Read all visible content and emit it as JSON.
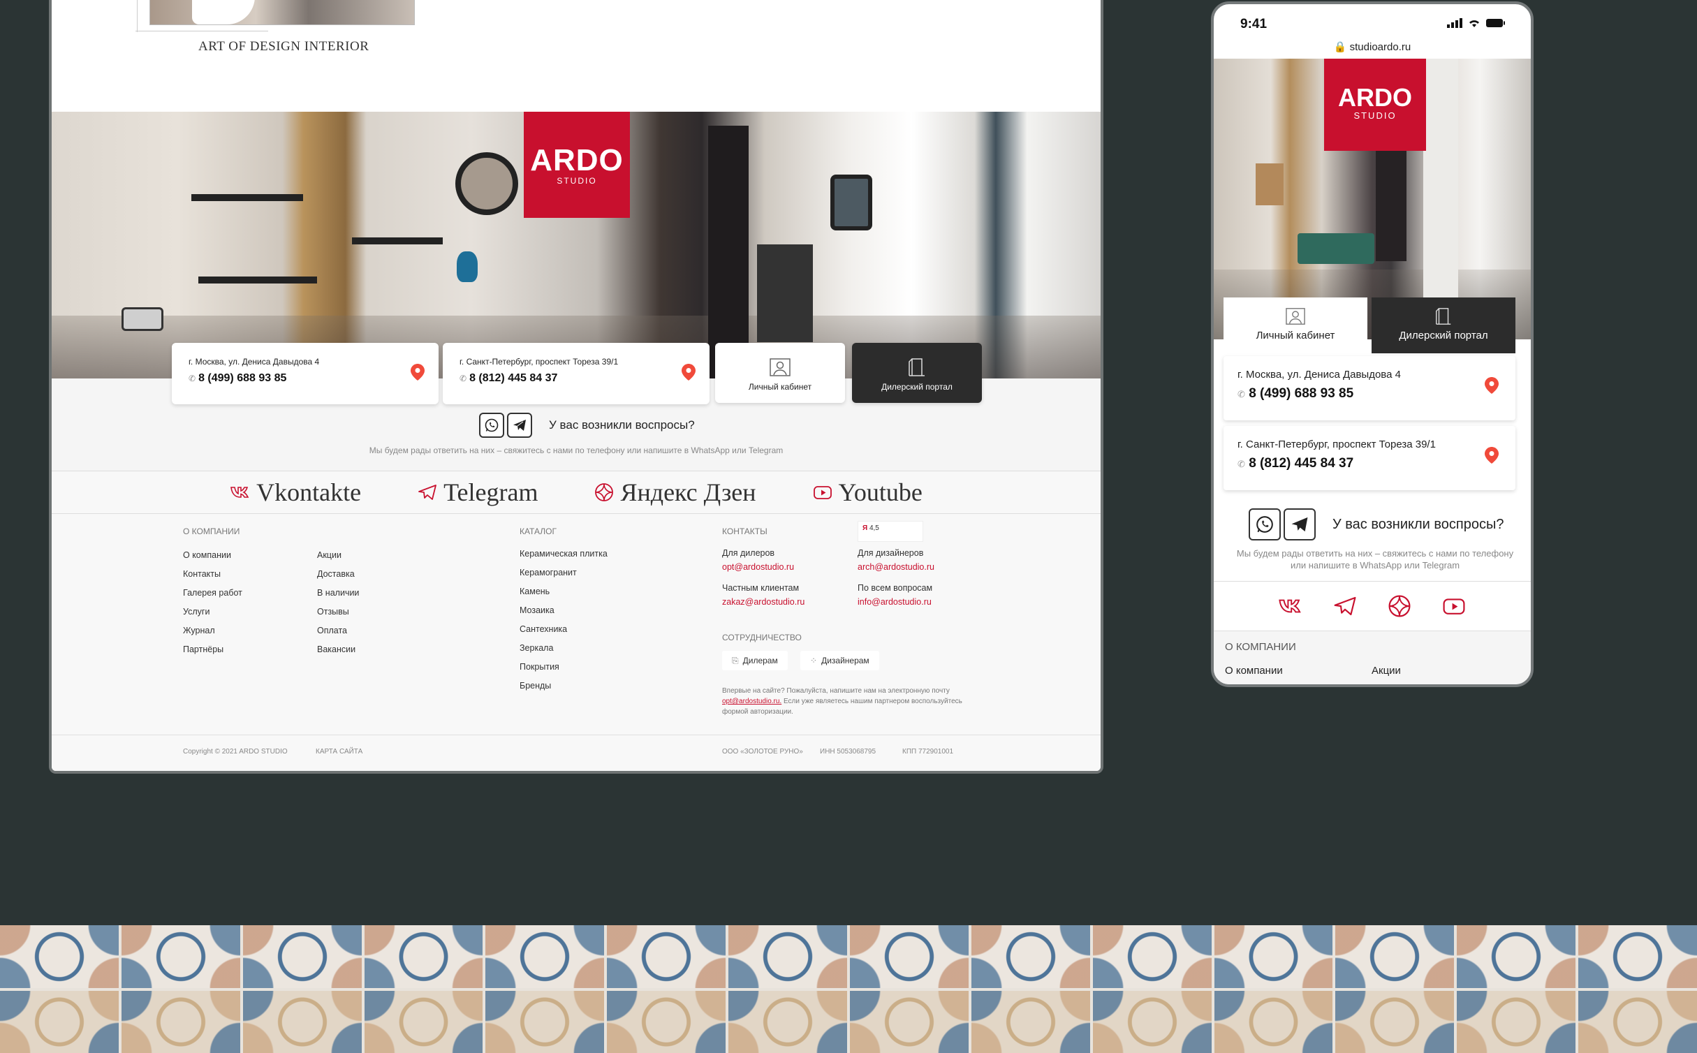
{
  "brand": {
    "name": "ARDO",
    "sub": "STUDIO",
    "tagline": "ART OF DESIGN INTERIOR",
    "accent": "#c8102e",
    "dark": "#2c2c2c",
    "background": "#2b3434"
  },
  "contacts": {
    "moscow": {
      "address": "г. Москва, ул. Дениса Давыдова 4",
      "phone": "8 (499) 688 93 85"
    },
    "spb": {
      "address": "г. Санкт-Петербург, проспект Тореза 39/1",
      "phone": "8 (812) 445 84 37"
    }
  },
  "buttons": {
    "cabinet": "Личный кабинет",
    "dealer": "Дилерский портал"
  },
  "question": {
    "title": "У вас возникли воспросы?",
    "subtitle": "Мы будем рады ответить на них – свяжитесь с нами по телефону или напишите в WhatsApp или Telegram",
    "mobile_sub_1": "Мы будем рады ответить на них – свяжитесь с нами по телефону",
    "mobile_sub_2": "или напишите в WhatsApp или Telegram"
  },
  "social": [
    {
      "label": "Vkontakte",
      "icon": "vk-icon"
    },
    {
      "label": "Telegram",
      "icon": "telegram-icon"
    },
    {
      "label": "Яндекс Дзен",
      "icon": "zen-icon"
    },
    {
      "label": "Youtube",
      "icon": "youtube-icon"
    }
  ],
  "footer": {
    "company_title": "О КОМПАНИИ",
    "company_col1": [
      "О компании",
      "Контакты",
      "Галерея работ",
      "Услуги",
      "Журнал",
      "Партнёры"
    ],
    "company_col2": [
      "Акции",
      "Доставка",
      "В наличии",
      "Отзывы",
      "Оплата",
      "Вакансии"
    ],
    "catalog_title": "КАТАЛОГ",
    "catalog": [
      "Керамическая плитка",
      "Керамогранит",
      "Камень",
      "Мозаика",
      "Сантехника",
      "Зеркала",
      "Покрытия",
      "Бренды"
    ],
    "contacts_title": "КОНТАКТЫ",
    "rating": {
      "brand": "Я",
      "value": "4,5"
    },
    "dealers_label": "Для дилеров",
    "dealers_mail": "opt@ardostudio.ru",
    "designers_label": "Для дизайнеров",
    "designers_mail": "arch@ardostudio.ru",
    "private_label": "Частным клиентам",
    "private_mail": "zakaz@ardostudio.ru",
    "all_label": "По всем вопросам",
    "all_mail": "info@ardostudio.ru",
    "coop_title": "СОТРУДНИЧЕСТВО",
    "coop_dealers": "Дилерам",
    "coop_designers": "Дизайнерам",
    "note_1": "Впервые на сайте? Пожалуйста, напишите нам на электронную почту",
    "note_mail": "opt@ardostudio.ru.",
    "note_2": "Если уже являетесь нашим партнером воспользуйтесь формой авторизации."
  },
  "bottom": {
    "copyright": "Copyright © 2021 ARDO STUDIO",
    "sitemap": "КАРТА САЙТА",
    "company": "ООО «ЗОЛОТОЕ РУНО»",
    "inn": "ИНН 5053068795",
    "kpp": "КПП 772901001"
  },
  "mobile": {
    "time": "9:41",
    "url": "studioardo.ru",
    "foot_title": "О КОМПАНИИ",
    "foot_item1": "О компании",
    "foot_item2": "Акции"
  }
}
